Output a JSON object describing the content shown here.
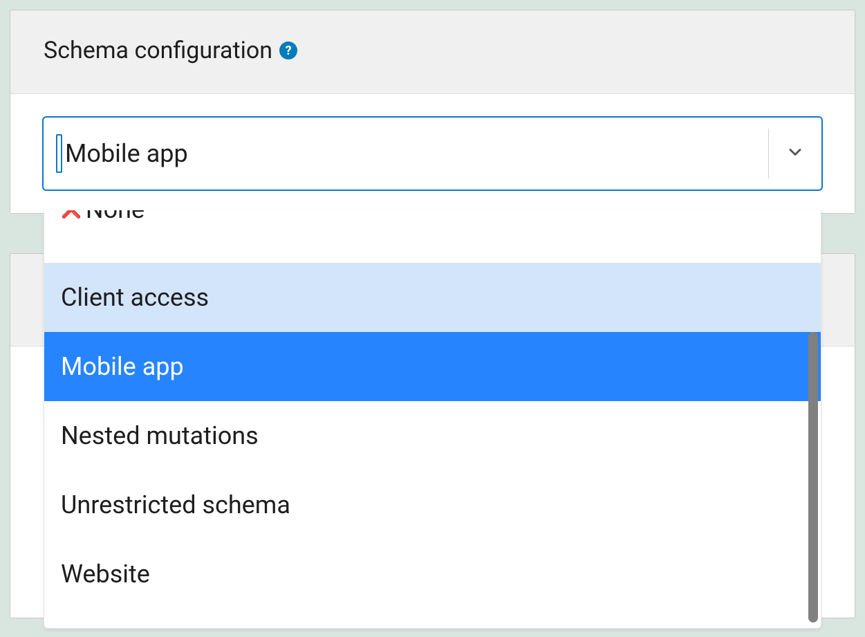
{
  "panel": {
    "title": "Schema configuration",
    "help_icon_label": "?"
  },
  "select": {
    "value": "Mobile app"
  },
  "dropdown": {
    "peeking_option": "None",
    "options": [
      {
        "label": "Client access",
        "state": "highlighted"
      },
      {
        "label": "Mobile app",
        "state": "selected"
      },
      {
        "label": "Nested mutations",
        "state": "normal"
      },
      {
        "label": "Unrestricted schema",
        "state": "normal"
      },
      {
        "label": "Website",
        "state": "normal"
      }
    ]
  }
}
